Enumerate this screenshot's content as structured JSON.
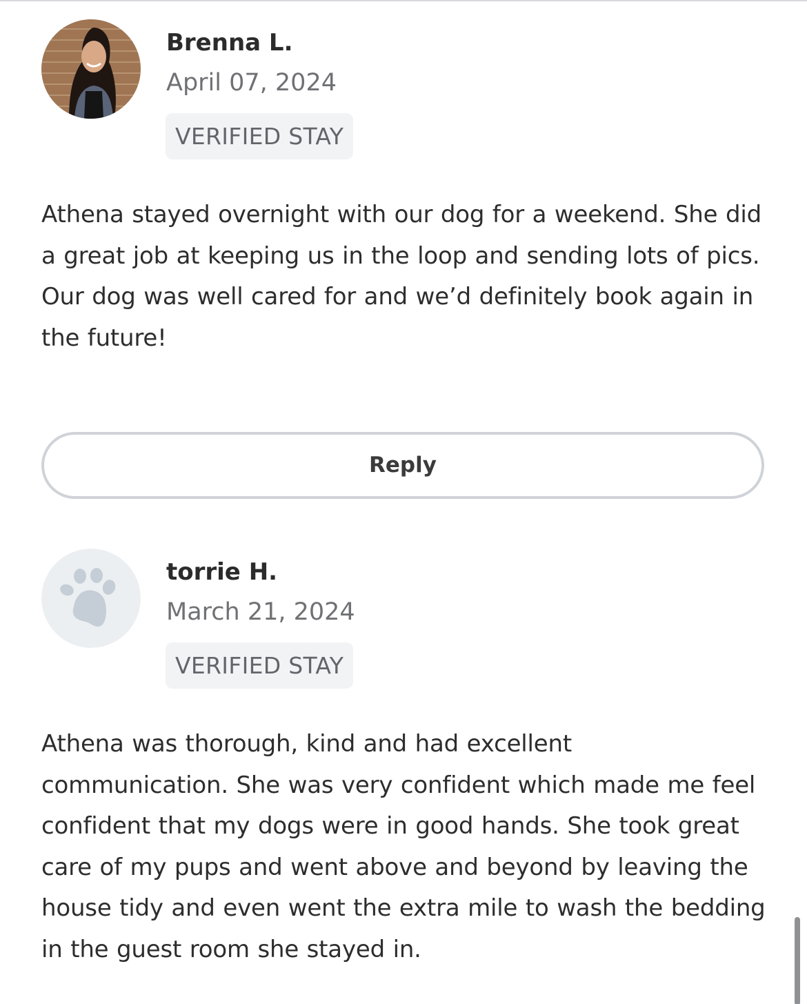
{
  "reviews": [
    {
      "name": "Brenna L.",
      "date": "April 07, 2024",
      "badge": "VERIFIED STAY",
      "text": "Athena stayed overnight with our dog for a weekend. She did a great job at keeping us in the loop and sending lots of pics. Our dog was well cared for and we’d definitely book again in the future!",
      "avatar": "user-photo"
    },
    {
      "name": "torrie H.",
      "date": "March 21, 2024",
      "badge": "VERIFIED STAY",
      "text": "Athena was thorough, kind and had excellent communication.  She was very confident which made me feel confident that my dogs were in good hands.  She took great care of my pups and went above and beyond by leaving the house tidy and even went the extra mile to wash the bedding in the guest room she stayed in.",
      "avatar": "paw-icon"
    }
  ],
  "reply": {
    "label": "Reply"
  },
  "colors": {
    "badge_bg": "#f2f3f5",
    "button_border": "#cfd3d8",
    "placeholder_avatar_bg": "#eceff2",
    "paw": "#c5ced6"
  }
}
